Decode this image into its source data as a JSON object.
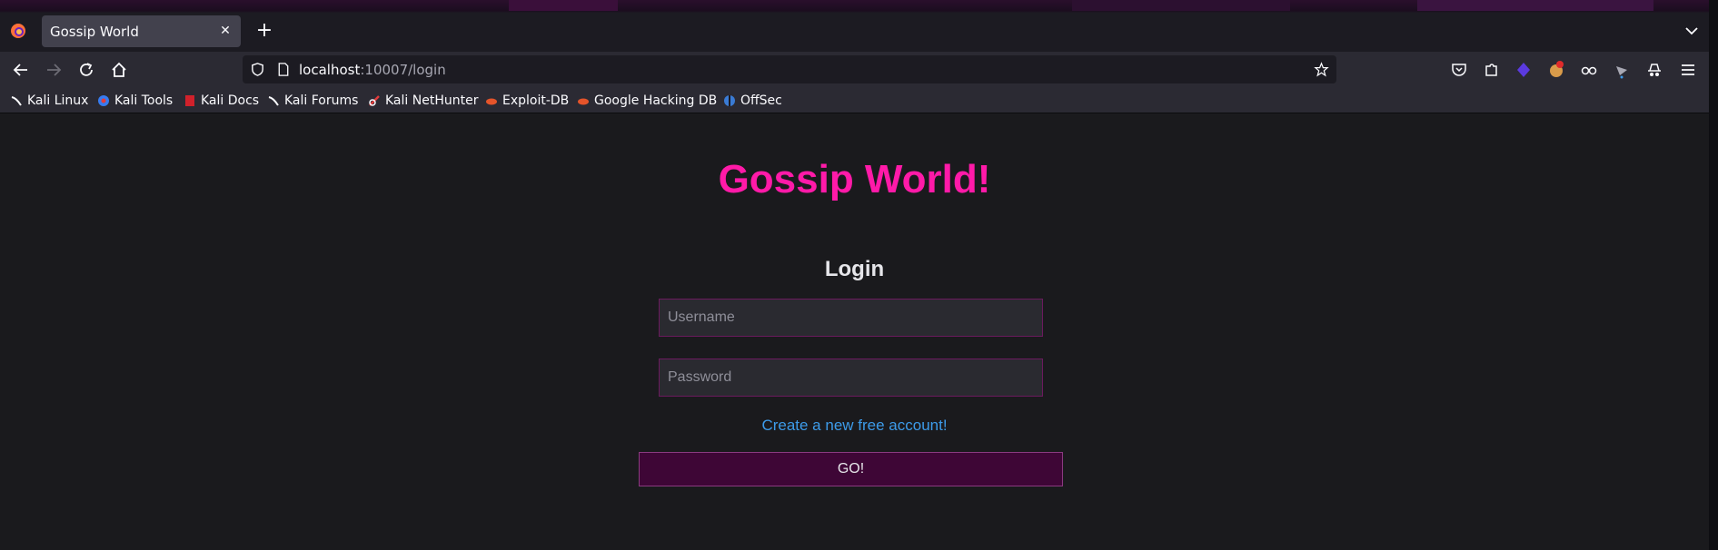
{
  "browser": {
    "tab_title": "Gossip World",
    "url_host": "localhost",
    "url_path": ":10007/login"
  },
  "bookmarks": [
    {
      "label": "Kali Linux",
      "icon": "kali-dragon-icon"
    },
    {
      "label": "Kali Tools",
      "icon": "kali-tools-icon"
    },
    {
      "label": "Kali Docs",
      "icon": "kali-docs-icon"
    },
    {
      "label": "Kali Forums",
      "icon": "kali-forums-icon"
    },
    {
      "label": "Kali NetHunter",
      "icon": "nethunter-icon"
    },
    {
      "label": "Exploit-DB",
      "icon": "exploit-db-icon"
    },
    {
      "label": "Google Hacking DB",
      "icon": "ghdb-icon"
    },
    {
      "label": "OffSec",
      "icon": "offsec-icon"
    }
  ],
  "page": {
    "site_title": "Gossip World!",
    "login_heading": "Login",
    "username_placeholder": "Username",
    "password_placeholder": "Password",
    "create_account_link": "Create a new free account!",
    "submit_label": "GO!"
  },
  "colors": {
    "brand": "#ff1aa8",
    "link": "#3d9be9",
    "button_bg": "#3e0636"
  }
}
